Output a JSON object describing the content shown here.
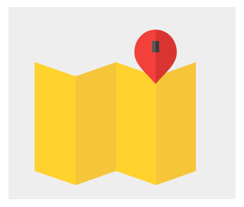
{
  "icon": {
    "name": "folded-map-with-location-pin",
    "colors": {
      "background": "#eeeeee",
      "map_light": "#ffd22e",
      "map_dark": "#f5c53a",
      "pin_light": "#f2403a",
      "pin_dark": "#d93431",
      "pin_hole_light": "#5a5a5a",
      "pin_hole_dark": "#3c3c3c"
    }
  }
}
